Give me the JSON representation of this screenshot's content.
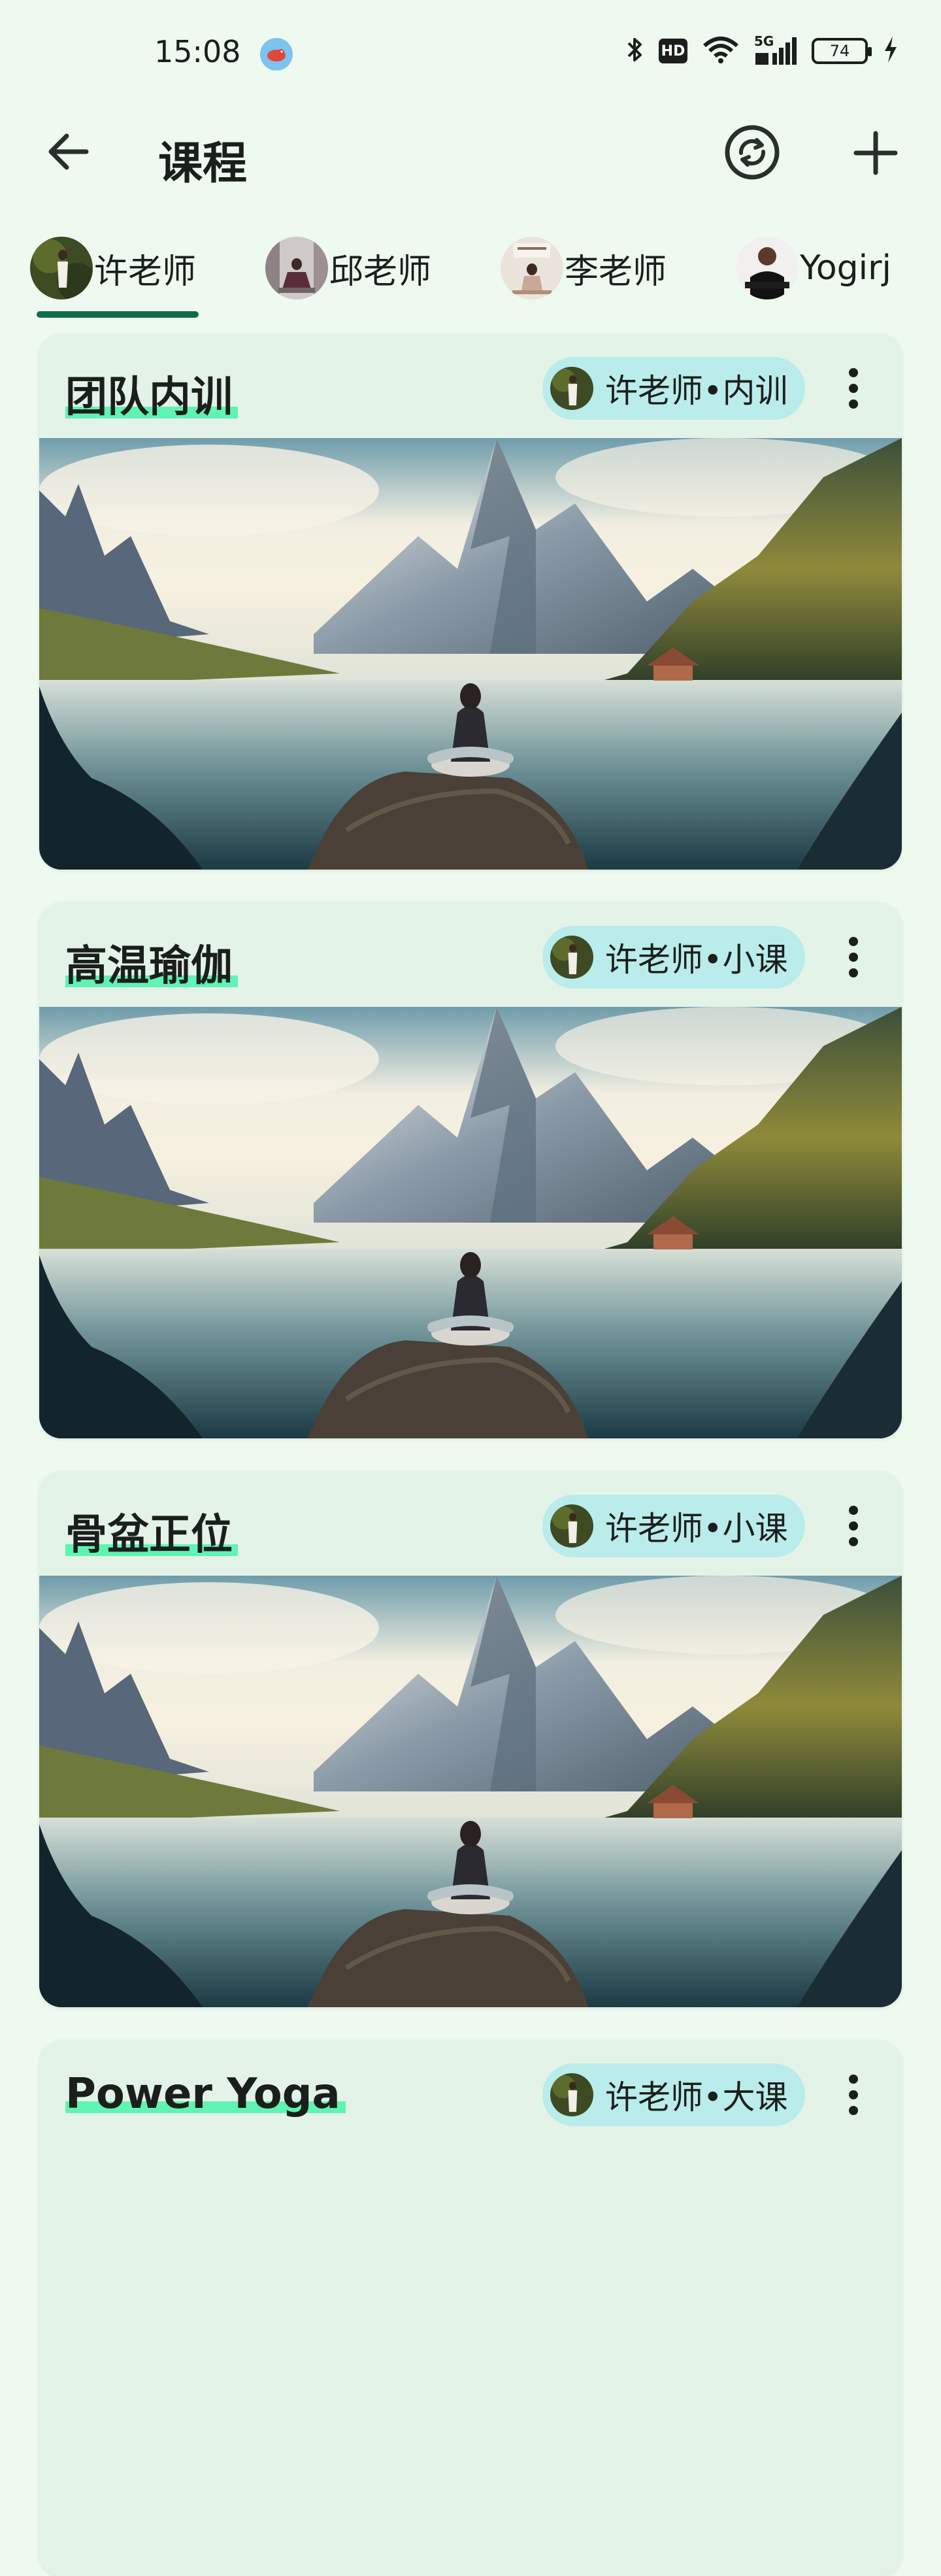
{
  "status_bar": {
    "time": "15:08",
    "network": "5G",
    "hd_badge": "HD",
    "battery": "74"
  },
  "app_bar": {
    "title": "课程",
    "back_icon": "arrow-left-icon",
    "sync_icon": "sync-icon",
    "add_icon": "plus-icon"
  },
  "tabs": [
    {
      "label": "许老师",
      "selected": true
    },
    {
      "label": "邱老师",
      "selected": false
    },
    {
      "label": "李老师",
      "selected": false
    },
    {
      "label": "Yogirj",
      "selected": false
    }
  ],
  "courses": [
    {
      "title": "团队内训",
      "tag": "许老师•内训"
    },
    {
      "title": "高温瑜伽",
      "tag": "许老师•小课"
    },
    {
      "title": "骨盆正位",
      "tag": "许老师•小课"
    },
    {
      "title": "Power Yoga",
      "tag": "许老师•大课"
    }
  ],
  "colors": {
    "background": "#eef9f0",
    "card": "#e3f3e8",
    "chip": "#b9ecea",
    "title_highlight": "#5ff3b4",
    "tab_indicator": "#0e6d4c"
  }
}
